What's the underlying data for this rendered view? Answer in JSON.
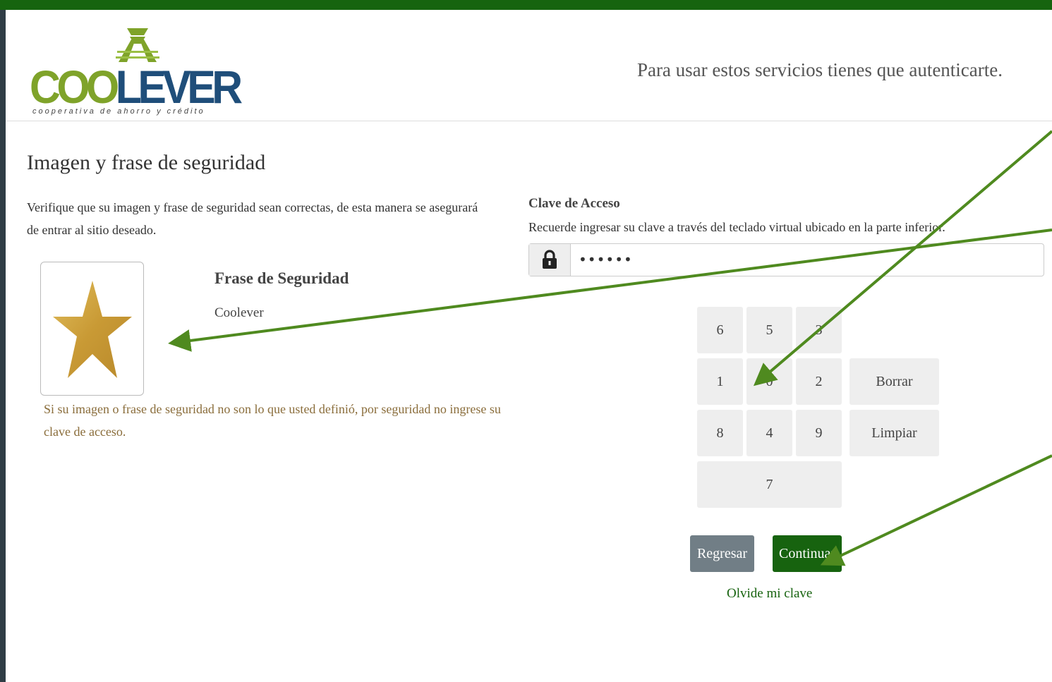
{
  "brand": {
    "logo_part1": "COO",
    "logo_part2": "LEVER",
    "logo_tagline": "cooperativa de ahorro y crédito"
  },
  "header": {
    "message": "Para usar estos servicios tienes que autenticarte."
  },
  "security": {
    "title": "Imagen y frase de seguridad",
    "description": "Verifique que su imagen y frase de seguridad sean correctas, de esta manera se asegurará de entrar al sitio deseado.",
    "image_icon": "gold-star",
    "phrase_title": "Frase de Seguridad",
    "phrase_value": "Coolever",
    "warning": "Si su imagen o frase de seguridad no son lo que usted definió, por seguridad no ingrese su clave de acceso."
  },
  "password": {
    "label": "Clave de Acceso",
    "help": "Recuerde ingresar su clave a través del teclado virtual ubicado en la parte inferior.",
    "masked_value": "••••••",
    "icon": "lock-icon"
  },
  "keypad": {
    "row1": [
      "6",
      "5",
      "3"
    ],
    "row2": [
      "1",
      "0",
      "2"
    ],
    "row3": [
      "8",
      "4",
      "9"
    ],
    "row4": [
      "7"
    ],
    "delete_label": "Borrar",
    "clear_label": "Limpiar"
  },
  "actions": {
    "back_label": "Regresar",
    "continue_label": "Continuar",
    "forgot_label": "Olvide mi clave"
  },
  "colors": {
    "brand_green": "#16640f",
    "logo_green": "#7fa32a",
    "logo_blue": "#1f4e7a",
    "annotation_arrow": "#4f8a1f",
    "warning_text": "#8a6d3b"
  }
}
